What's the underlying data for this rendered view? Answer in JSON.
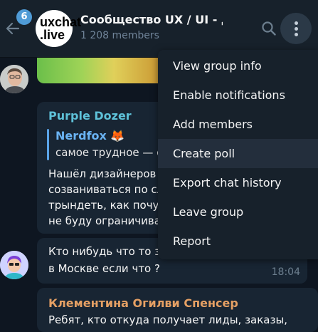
{
  "header": {
    "unread_count": "6",
    "avatar_text_line1": "uxchat",
    "avatar_text_line2": ".live",
    "title": "Сообщество UX / UI - д...",
    "members": "1 208 members"
  },
  "messages": [
    {
      "sender": "Purple Dozer",
      "reply_to": {
        "name": "Nerdfox 🦊",
        "text": "самое трудное — с"
      },
      "lines": [
        "Нашёл дизайнеров",
        "созваниваться по сл",
        "трындеть, как почуве",
        "не буду ограничива"
      ]
    },
    {
      "sender": "",
      "lines": [
        "Кто нибудь что то зн",
        "в Москве если что ?"
      ],
      "time": "18:04"
    },
    {
      "sender": "Клементина Огилви Спенсер",
      "lines": [
        "Ребят, кто откуда получает лиды, заказы,"
      ]
    }
  ],
  "menu": {
    "items": [
      "View group info",
      "Enable notifications",
      "Add members",
      "Create poll",
      "Export chat history",
      "Leave group",
      "Report"
    ],
    "hovered_index": 3
  },
  "colors": {
    "background": "#0e1621",
    "header": "#17212b",
    "bubble": "#182533",
    "accent": "#4f9bd6",
    "sender_purple": "#5ec1d8",
    "sender_orange": "#e5a064"
  },
  "icons": [
    "back-arrow-icon",
    "search-icon",
    "more-vertical-icon"
  ]
}
